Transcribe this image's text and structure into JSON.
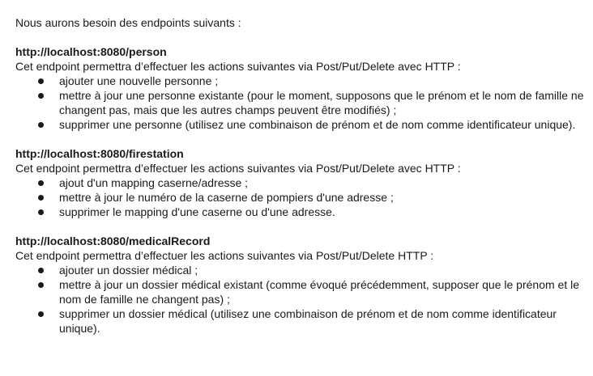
{
  "intro": "Nous aurons besoin des endpoints suivants :",
  "sections": [
    {
      "url": "http://localhost:8080/person",
      "description": "Cet endpoint permettra d’effectuer les actions suivantes via Post/Put/Delete avec HTTP :",
      "items": [
        "ajouter une nouvelle personne ;",
        "mettre à jour une personne existante (pour le moment, supposons que le prénom et le nom de famille ne changent pas, mais que les autres champs peuvent être modifiés) ;",
        "supprimer une personne (utilisez une combinaison de prénom et de nom comme identificateur unique)."
      ]
    },
    {
      "url": "http://localhost:8080/firestation",
      "description": "Cet endpoint permettra d’effectuer les actions suivantes via Post/Put/Delete avec HTTP :",
      "items": [
        "ajout d'un mapping caserne/adresse ;",
        "mettre à jour le numéro de la caserne de pompiers d'une adresse ;",
        "supprimer le mapping d'une caserne ou d'une adresse."
      ]
    },
    {
      "url": "http://localhost:8080/medicalRecord",
      "description": "Cet endpoint permettra d’effectuer les actions suivantes via Post/Put/Delete HTTP :",
      "items": [
        "ajouter un dossier médical ;",
        "mettre à jour un dossier médical existant (comme évoqué précédemment, supposer que le prénom et le nom de famille ne changent pas) ;",
        "supprimer un dossier médical (utilisez une combinaison de prénom et de nom comme identificateur unique)."
      ]
    }
  ]
}
